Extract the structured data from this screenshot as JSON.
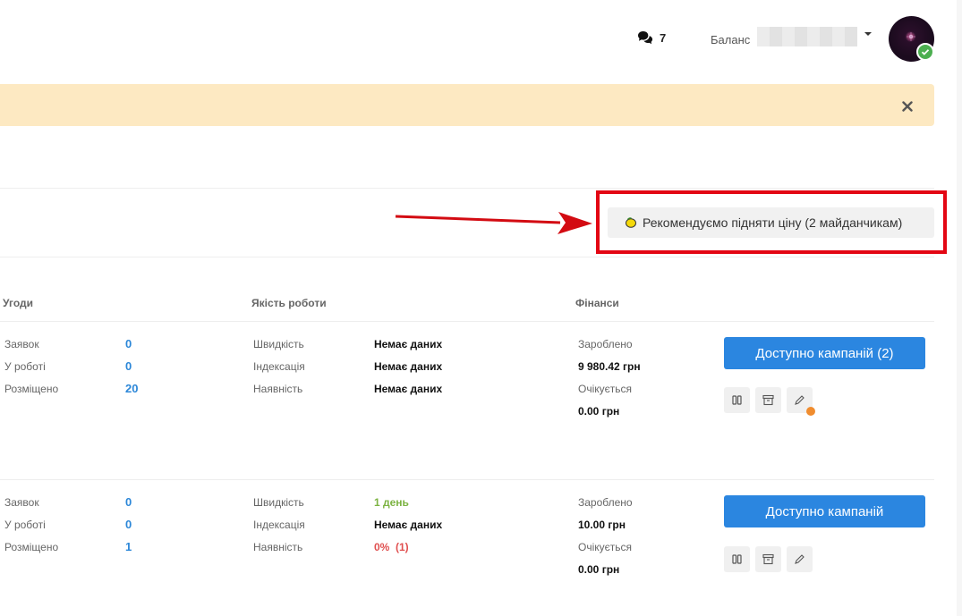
{
  "header": {
    "messages_count": "7",
    "balance_label": "Баланс",
    "colors": {
      "verified": "#4caf50"
    }
  },
  "alert": {
    "close_icon": "close-icon",
    "color": "#fde9c2"
  },
  "recommendation": {
    "label": "Рекомендуємо підняти ціну (2 майданчикам)",
    "icon": "lemon-icon",
    "highlight_color": "#e30613"
  },
  "columns": {
    "deals": "Угоди",
    "quality": "Якість роботи",
    "finance": "Фінанси"
  },
  "rows": [
    {
      "applications_label": "Заявок",
      "applications": "0",
      "in_work_label": "У роботі",
      "in_work": "0",
      "placed_label": "Розміщено",
      "placed": "20",
      "speed_label": "Швидкість",
      "speed": "Немає даних",
      "indexing_label": "Індексація",
      "indexing": "Немає даних",
      "availability_label": "Наявність",
      "availability": "Немає даних",
      "earned_label": "Зароблено",
      "earned": "9 980.42 грн",
      "expected_label": "Очікується",
      "expected": "0.00 грн",
      "campaigns_button": "Доступно кампаній (2)"
    },
    {
      "applications_label": "Заявок",
      "applications": "0",
      "in_work_label": "У роботі",
      "in_work": "0",
      "placed_label": "Розміщено",
      "placed": "1",
      "speed_label": "Швидкість",
      "speed": "1 день",
      "indexing_label": "Індексація",
      "indexing": "Немає даних",
      "availability_label": "Наявність",
      "availability": "0%  (1)",
      "earned_label": "Зароблено",
      "earned": "10.00 грн",
      "expected_label": "Очікується",
      "expected": "0.00 грн",
      "campaigns_button": "Доступно кампаній"
    }
  ],
  "colors": {
    "accent_blue": "#2b86e0",
    "link_blue": "#2c87d8",
    "green": "#7cb342",
    "red": "#e05050",
    "notification_dot": "#f08c2e"
  }
}
